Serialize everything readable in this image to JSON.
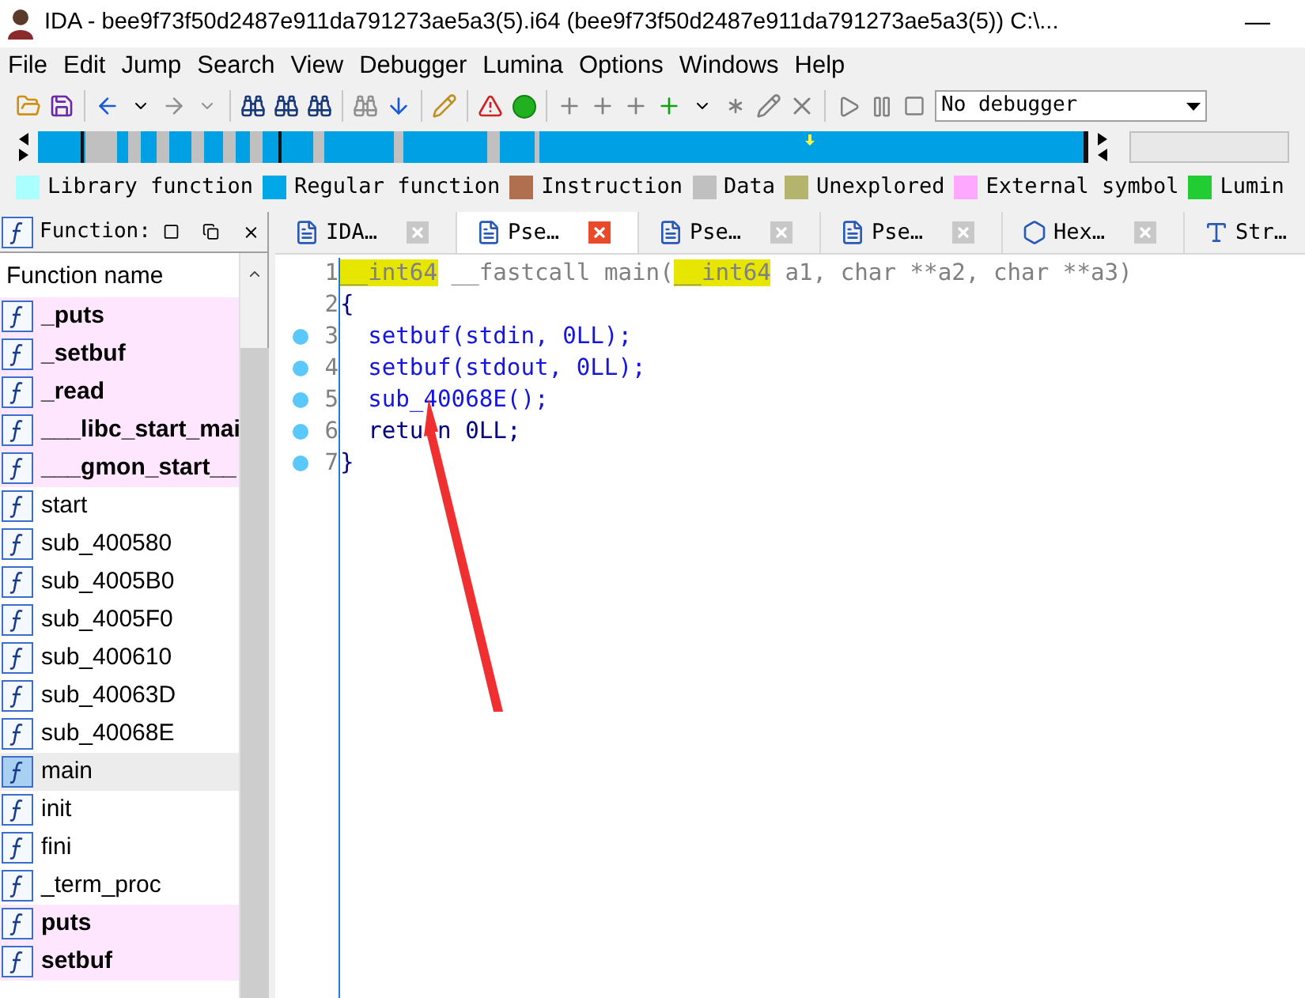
{
  "window": {
    "title": "IDA - bee9f73f50d2487e911da791273ae5a3(5).i64 (bee9f73f50d2487e911da791273ae5a3(5)) C:\\...",
    "minimize": "—"
  },
  "menu": [
    "File",
    "Edit",
    "Jump",
    "Search",
    "View",
    "Debugger",
    "Lumina",
    "Options",
    "Windows",
    "Help"
  ],
  "toolbar": {
    "debugger_select": "No debugger"
  },
  "legend": [
    {
      "label": "Library function",
      "color": "#aaffff"
    },
    {
      "label": "Regular function",
      "color": "#00a8e8"
    },
    {
      "label": "Instruction",
      "color": "#b07050"
    },
    {
      "label": "Data",
      "color": "#c0c0c0"
    },
    {
      "label": "Unexplored",
      "color": "#b4b46c"
    },
    {
      "label": "External symbol",
      "color": "#ffa8ff"
    },
    {
      "label": "Lumin",
      "color": "#22cc33"
    }
  ],
  "functions_panel": {
    "title": "Function:",
    "column": "Function name",
    "items": [
      {
        "name": "_puts",
        "kind": "external",
        "selected": false
      },
      {
        "name": "_setbuf",
        "kind": "external",
        "selected": false
      },
      {
        "name": "_read",
        "kind": "external",
        "selected": false
      },
      {
        "name": "___libc_start_mai",
        "kind": "external",
        "selected": false
      },
      {
        "name": "___gmon_start__",
        "kind": "external",
        "selected": false
      },
      {
        "name": "start",
        "kind": "regular",
        "selected": false
      },
      {
        "name": "sub_400580",
        "kind": "regular",
        "selected": false
      },
      {
        "name": "sub_4005B0",
        "kind": "regular",
        "selected": false
      },
      {
        "name": "sub_4005F0",
        "kind": "regular",
        "selected": false
      },
      {
        "name": "sub_400610",
        "kind": "regular",
        "selected": false
      },
      {
        "name": "sub_40063D",
        "kind": "regular",
        "selected": false
      },
      {
        "name": "sub_40068E",
        "kind": "regular",
        "selected": false
      },
      {
        "name": "main",
        "kind": "regular",
        "selected": true
      },
      {
        "name": "init",
        "kind": "regular",
        "selected": false
      },
      {
        "name": "fini",
        "kind": "regular",
        "selected": false
      },
      {
        "name": "_term_proc",
        "kind": "regular",
        "selected": false
      },
      {
        "name": "puts",
        "kind": "external",
        "selected": false
      },
      {
        "name": "setbuf",
        "kind": "external",
        "selected": false
      }
    ]
  },
  "tabs": [
    {
      "label": "IDA…",
      "kind": "text",
      "selected": false,
      "closable": true
    },
    {
      "label": "Pse…",
      "kind": "text",
      "selected": true,
      "closable": true
    },
    {
      "label": "Pse…",
      "kind": "text",
      "selected": false,
      "closable": true
    },
    {
      "label": "Pse…",
      "kind": "text",
      "selected": false,
      "closable": true
    },
    {
      "label": "Hex…",
      "kind": "hex",
      "selected": false,
      "closable": true
    },
    {
      "label": "Str…",
      "kind": "strings",
      "selected": false,
      "closable": false
    }
  ],
  "code": [
    {
      "number": "1",
      "breakpoint": false,
      "segments": [
        {
          "text": "__int64",
          "kind": "highlight"
        },
        {
          "text": " __fastcall main(",
          "kind": "proto"
        },
        {
          "text": "__int64",
          "kind": "highlight"
        },
        {
          "text": " a1, char **a2, char **a3)",
          "kind": "proto"
        }
      ]
    },
    {
      "number": "2",
      "breakpoint": false,
      "segments": [
        {
          "text": "{",
          "kind": "plain"
        }
      ]
    },
    {
      "number": "3",
      "breakpoint": true,
      "segments": [
        {
          "text": "  setbuf(stdin, 0LL);",
          "kind": "code"
        }
      ]
    },
    {
      "number": "4",
      "breakpoint": true,
      "segments": [
        {
          "text": "  setbuf(stdout, 0LL);",
          "kind": "code"
        }
      ]
    },
    {
      "number": "5",
      "breakpoint": true,
      "segments": [
        {
          "text": "  sub_40068E();",
          "kind": "code"
        }
      ]
    },
    {
      "number": "6",
      "breakpoint": true,
      "segments": [
        {
          "text": "  retu",
          "kind": "plain"
        },
        {
          "text": "n 0LL;",
          "kind": "plain_after_gap"
        }
      ]
    },
    {
      "number": "7",
      "breakpoint": true,
      "segments": [
        {
          "text": "}",
          "kind": "plain"
        }
      ]
    }
  ]
}
